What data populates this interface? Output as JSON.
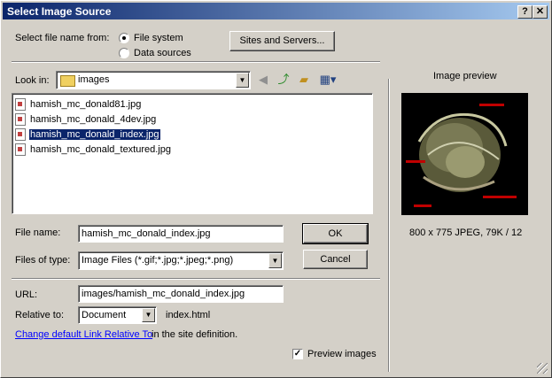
{
  "window": {
    "title": "Select Image Source",
    "help_button": "?",
    "close_button": "✕"
  },
  "source": {
    "label": "Select file name from:",
    "options": [
      "File system",
      "Data sources"
    ],
    "selected": "File system",
    "sites_button": "Sites and Servers..."
  },
  "lookin": {
    "label": "Look in:",
    "folder": "images"
  },
  "files": [
    {
      "name": "hamish_mc_donald81.jpg",
      "selected": false
    },
    {
      "name": "hamish_mc_donald_4dev.jpg",
      "selected": false
    },
    {
      "name": "hamish_mc_donald_index.jpg",
      "selected": true
    },
    {
      "name": "hamish_mc_donald_textured.jpg",
      "selected": false
    }
  ],
  "filename": {
    "label": "File name:",
    "value": "hamish_mc_donald_index.jpg",
    "ok_button": "OK"
  },
  "filetype": {
    "label": "Files of type:",
    "value": "Image Files (*.gif;*.jpg;*.jpeg;*.png)",
    "cancel_button": "Cancel"
  },
  "url": {
    "label": "URL:",
    "value": "images/hamish_mc_donald_index.jpg"
  },
  "relative": {
    "label": "Relative to:",
    "value": "Document",
    "doc": "index.html"
  },
  "link_note": {
    "link": "Change default Link Relative To",
    "rest": " in the site definition."
  },
  "preview": {
    "title": "Image preview",
    "info": "800 x 775 JPEG, 79K / 12",
    "checkbox_label": "Preview images",
    "checked": true
  },
  "colors": {
    "title_bar": "#0a246a",
    "selection": "#0a246a",
    "link": "#0000ff",
    "preview_bg": "#000000"
  }
}
